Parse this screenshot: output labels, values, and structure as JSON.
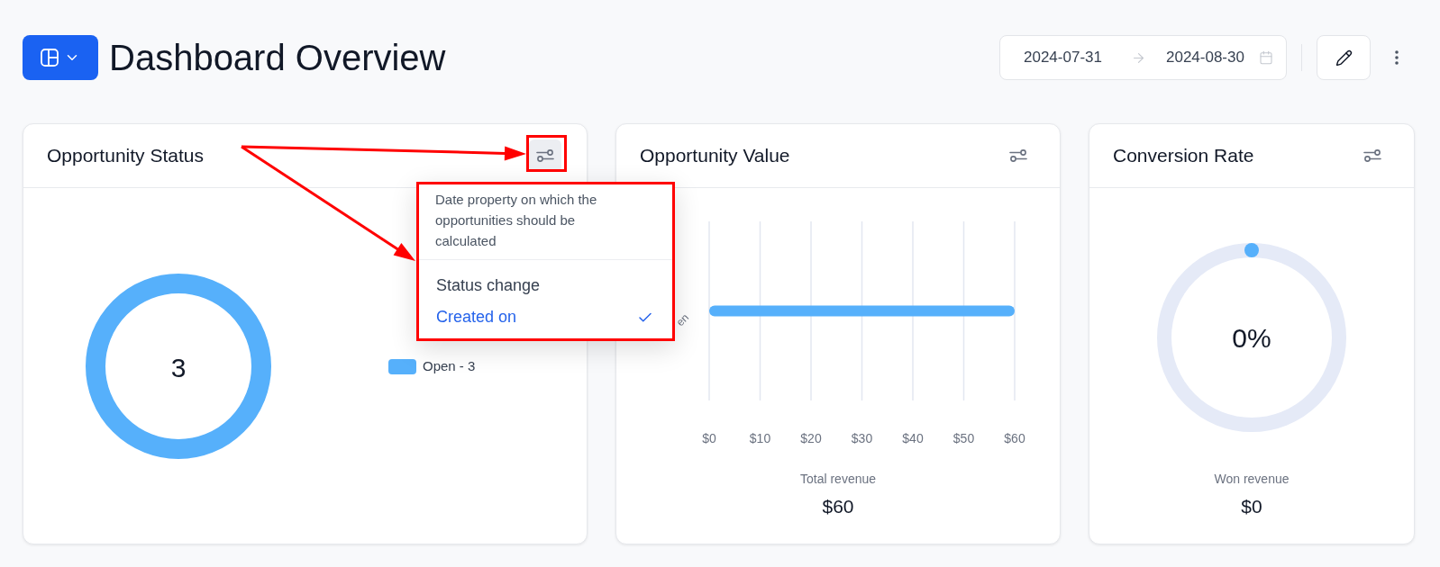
{
  "header": {
    "title": "Dashboard Overview",
    "date_range": {
      "start": "2024-07-31",
      "end": "2024-08-30"
    }
  },
  "cards": [
    {
      "kind": "donut",
      "title": "Opportunity Status",
      "filter_active": true,
      "center_value": "3",
      "legend": [
        {
          "label": "Open - 3",
          "color": "#56b0fb"
        }
      ]
    },
    {
      "kind": "bar",
      "title": "Opportunity Value",
      "filter_active": false,
      "chart_data": {
        "type": "bar",
        "orientation": "horizontal",
        "grid": true,
        "categories": [
          "en"
        ],
        "series": [
          {
            "color": "#56b0fb",
            "values": [
              60
            ]
          }
        ],
        "xlim": [
          0,
          60
        ],
        "xticks": [
          {
            "value": 0,
            "label": "$0"
          },
          {
            "value": 10,
            "label": "$10"
          },
          {
            "value": 20,
            "label": "$20"
          },
          {
            "value": 30,
            "label": "$30"
          },
          {
            "value": 40,
            "label": "$40"
          },
          {
            "value": 50,
            "label": "$50"
          },
          {
            "value": 60,
            "label": "$60"
          }
        ]
      },
      "summary": {
        "label": "Total revenue",
        "value": "$60"
      }
    },
    {
      "kind": "ring",
      "title": "Conversion Rate",
      "filter_active": false,
      "center_value": "0%",
      "summary": {
        "label": "Won revenue",
        "value": "$0"
      }
    }
  ],
  "filter_menu": {
    "description": "Date property on which the opportunities should be calculated",
    "options": [
      {
        "label": "Status change",
        "selected": false
      },
      {
        "label": "Created on",
        "selected": true
      }
    ]
  }
}
